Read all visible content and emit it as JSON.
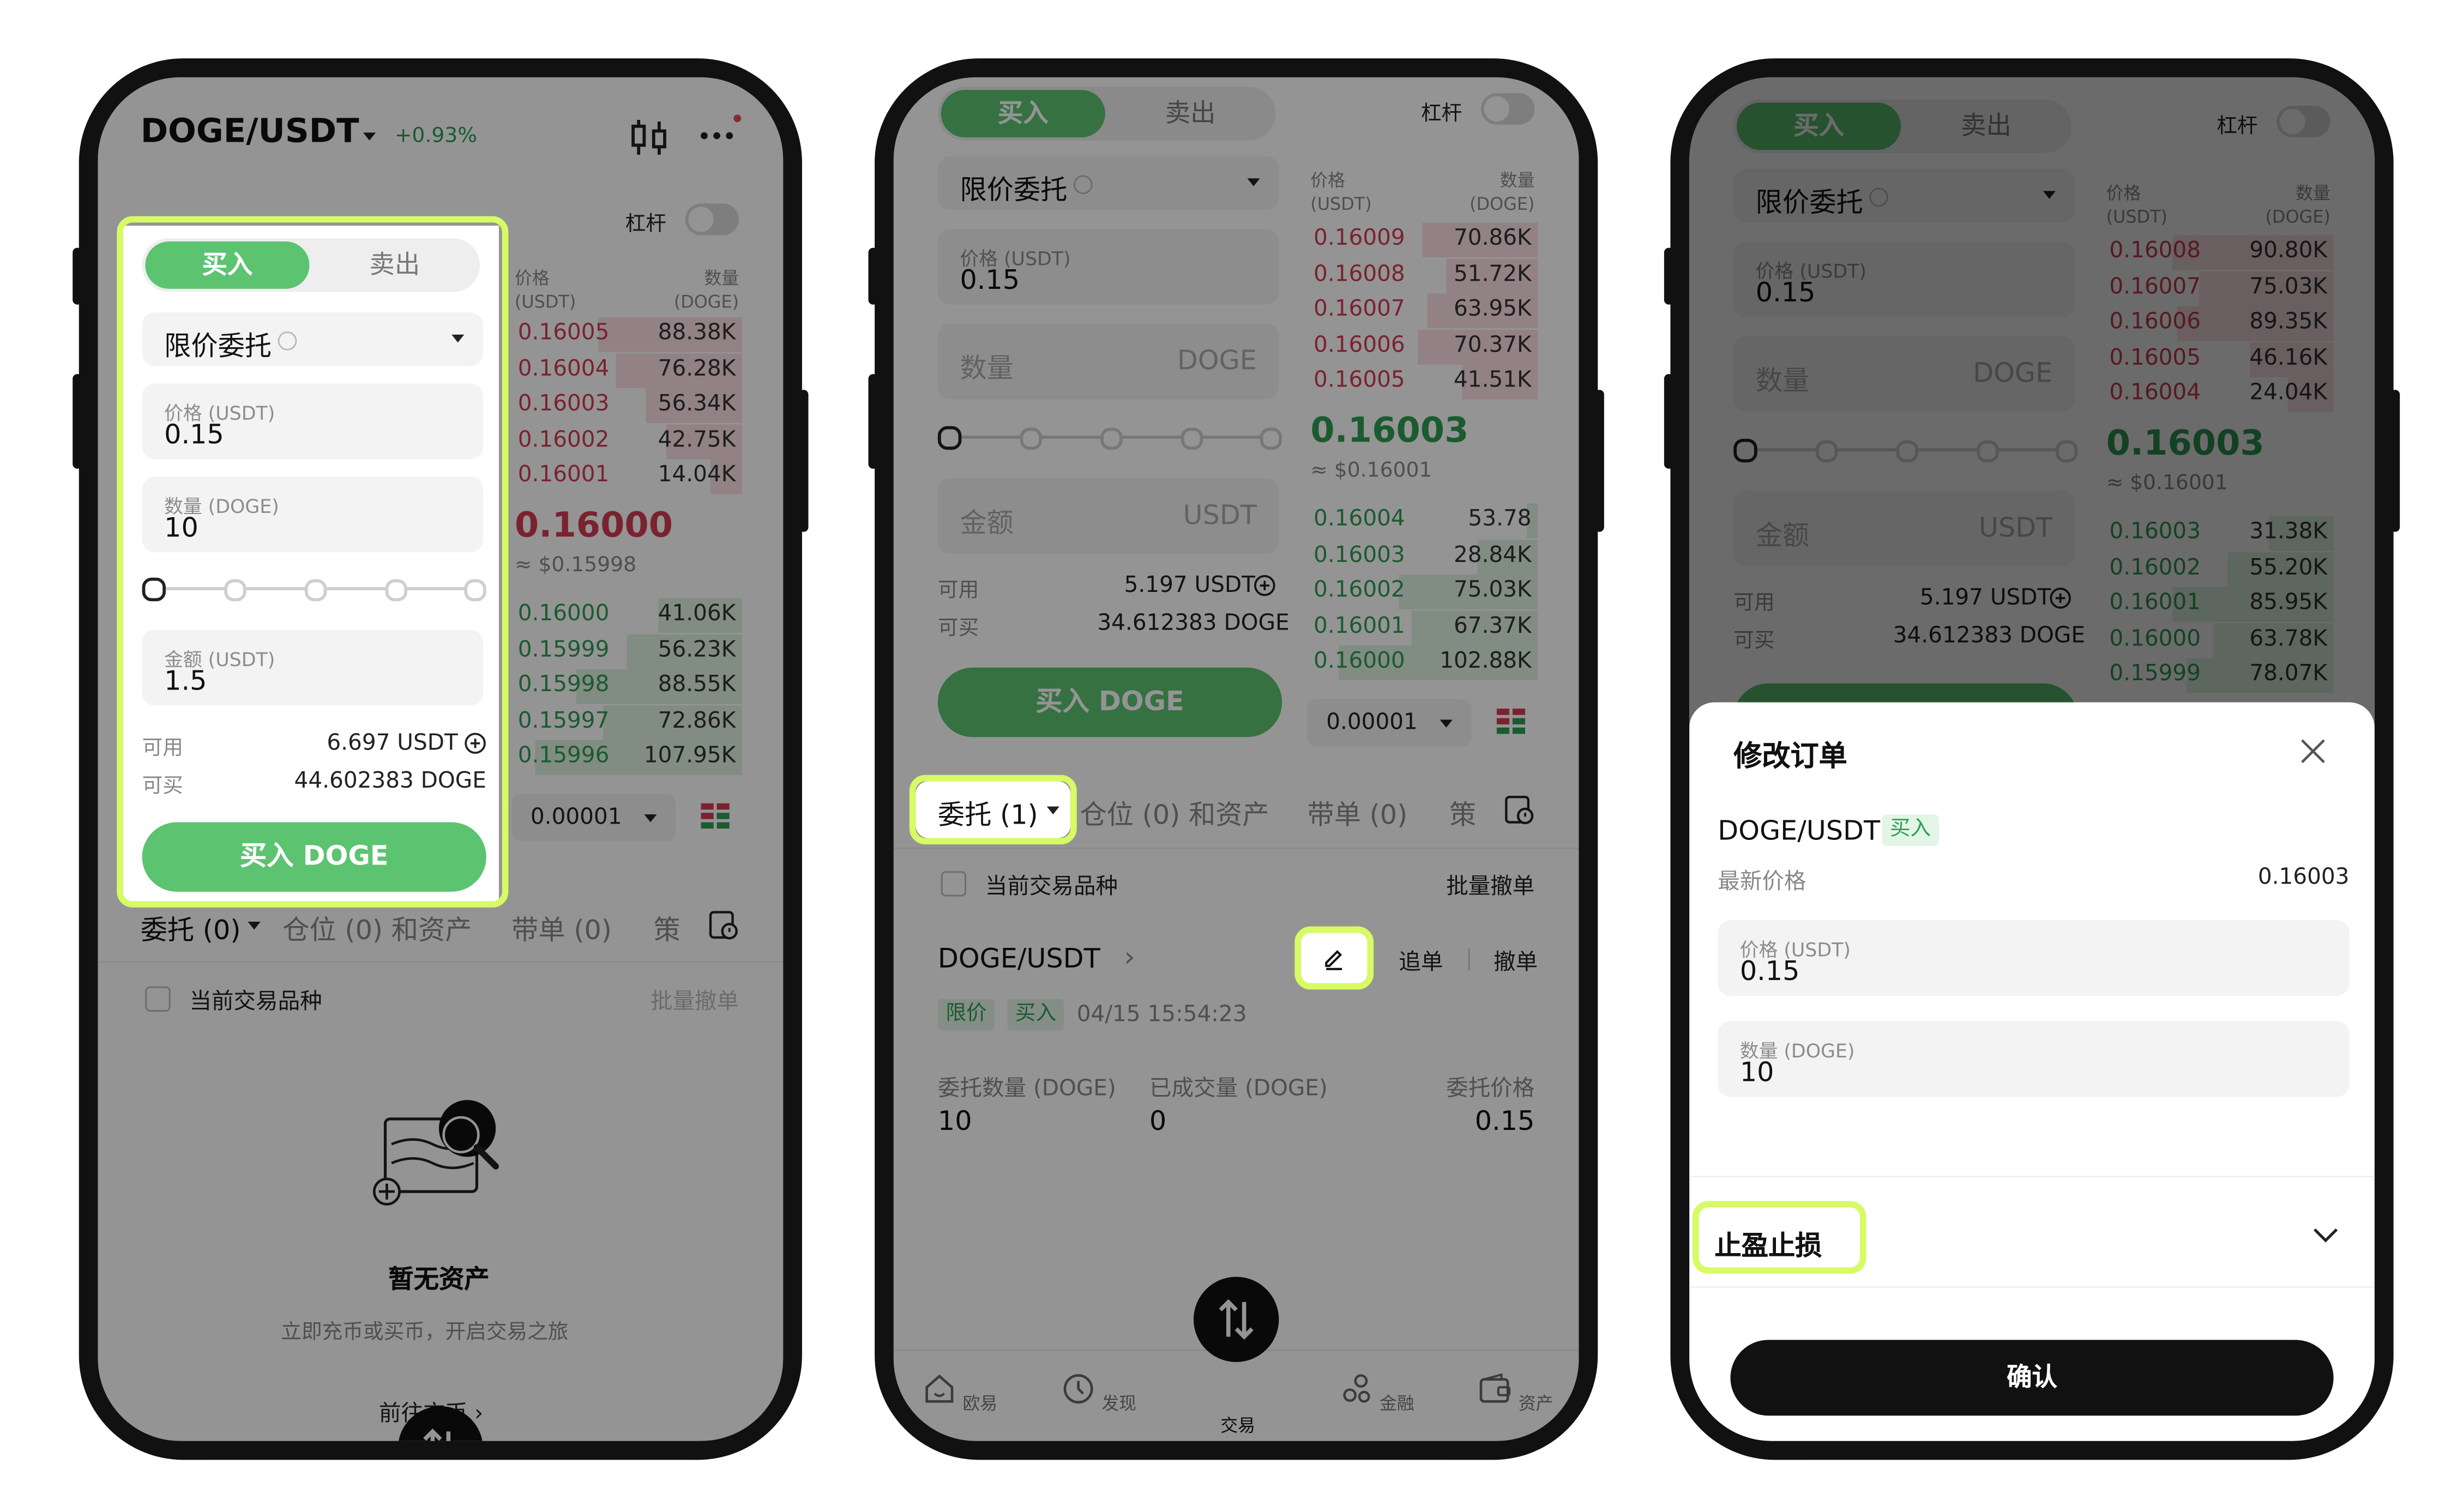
{
  "colors": {
    "buy_green": "#5cc371",
    "price_green": "#2e9d52",
    "price_red": "#d23b52",
    "highlight": "#d6fb64"
  },
  "screen1": {
    "pair": "DOGE/USDT",
    "change": "+0.93%",
    "buy_tab": "买入",
    "sell_tab": "卖出",
    "leverage_label": "杠杆",
    "order_type": "限价委托",
    "price_label": "价格 (USDT)",
    "price_value": "0.15",
    "qty_label": "数量 (DOGE)",
    "qty_value": "10",
    "amount_label": "金额 (USDT)",
    "amount_value": "1.5",
    "available_label": "可用",
    "available_value": "6.697 USDT",
    "can_buy_label": "可买",
    "can_buy_value": "44.602383 DOGE",
    "buy_button": "买入 DOGE",
    "book_price_header": "价格",
    "book_price_unit": "(USDT)",
    "book_qty_header": "数量",
    "book_qty_unit": "(DOGE)",
    "asks": [
      {
        "price": "0.16005",
        "qty": "88.38K",
        "depth": 0.62
      },
      {
        "price": "0.16004",
        "qty": "76.28K",
        "depth": 0.55
      },
      {
        "price": "0.16003",
        "qty": "56.34K",
        "depth": 0.42
      },
      {
        "price": "0.16002",
        "qty": "42.75K",
        "depth": 0.33
      },
      {
        "price": "0.16001",
        "qty": "14.04K",
        "depth": 0.14
      }
    ],
    "mid_price": "0.16000",
    "mid_usd": "≈ $0.15998",
    "bids": [
      {
        "price": "0.16000",
        "qty": "41.06K",
        "depth": 0.36
      },
      {
        "price": "0.15999",
        "qty": "56.23K",
        "depth": 0.5
      },
      {
        "price": "0.15998",
        "qty": "88.55K",
        "depth": 0.72
      },
      {
        "price": "0.15997",
        "qty": "72.86K",
        "depth": 0.6
      },
      {
        "price": "0.15996",
        "qty": "107.95K",
        "depth": 0.9
      }
    ],
    "step_value": "0.00001",
    "tabs": [
      "委托 (0)",
      "仓位 (0) 和资产",
      "带单 (0)",
      "策"
    ],
    "current_pair_label": "当前交易品种",
    "batch_cancel": "批量撤单",
    "empty_title": "暂无资产",
    "empty_desc": "立即充币或买币，开启交易之旅",
    "go_link": "前往充币"
  },
  "screen2": {
    "buy_tab": "买入",
    "sell_tab": "卖出",
    "leverage_label": "杠杆",
    "order_type": "限价委托",
    "price_label": "价格 (USDT)",
    "price_value": "0.15",
    "qty_placeholder": "数量",
    "qty_unit": "DOGE",
    "amount_placeholder": "金额",
    "amount_unit": "USDT",
    "available_label": "可用",
    "available_value": "5.197 USDT",
    "can_buy_label": "可买",
    "can_buy_value": "34.612383 DOGE",
    "buy_button": "买入 DOGE",
    "book_price_header": "价格",
    "book_price_unit": "(USDT)",
    "book_qty_header": "数量",
    "book_qty_unit": "(DOGE)",
    "asks": [
      {
        "price": "0.16009",
        "qty": "70.86K",
        "depth": 0.5
      },
      {
        "price": "0.16008",
        "qty": "51.72K",
        "depth": 0.4
      },
      {
        "price": "0.16007",
        "qty": "63.95K",
        "depth": 0.48
      },
      {
        "price": "0.16006",
        "qty": "70.37K",
        "depth": 0.52
      },
      {
        "price": "0.16005",
        "qty": "41.51K",
        "depth": 0.33
      }
    ],
    "mid_price": "0.16003",
    "mid_usd": "≈ $0.16001",
    "bids": [
      {
        "price": "0.16004",
        "qty": "53.78",
        "depth": 0.05
      },
      {
        "price": "0.16003",
        "qty": "28.84K",
        "depth": 0.26
      },
      {
        "price": "0.16002",
        "qty": "75.03K",
        "depth": 0.6
      },
      {
        "price": "0.16001",
        "qty": "67.37K",
        "depth": 0.55
      },
      {
        "price": "0.16000",
        "qty": "102.88K",
        "depth": 0.86
      }
    ],
    "step_value": "0.00001",
    "tabs": [
      "委托 (1)",
      "仓位 (0) 和资产",
      "带单 (0)",
      "策"
    ],
    "current_pair_label": "当前交易品种",
    "batch_cancel": "批量撤单",
    "order": {
      "pair": "DOGE/USDT",
      "chase": "追单",
      "cancel": "撤单",
      "tag_type": "限价",
      "tag_side": "买入",
      "time": "04/15 15:54:23",
      "qty_label": "委托数量 (DOGE)",
      "qty_value": "10",
      "filled_label": "已成交量 (DOGE)",
      "filled_value": "0",
      "price_label": "委托价格",
      "price_value": "0.15"
    },
    "nav": [
      {
        "label": "欧易",
        "icon": "home-icon"
      },
      {
        "label": "发现",
        "icon": "discover-icon"
      },
      {
        "label": "交易",
        "icon": "trade-icon"
      },
      {
        "label": "金融",
        "icon": "finance-icon"
      },
      {
        "label": "资产",
        "icon": "wallet-icon"
      }
    ]
  },
  "screen3": {
    "buy_tab": "买入",
    "sell_tab": "卖出",
    "leverage_label": "杠杆",
    "order_type": "限价委托",
    "price_label": "价格 (USDT)",
    "price_value": "0.15",
    "qty_placeholder": "数量",
    "qty_unit": "DOGE",
    "amount_placeholder": "金额",
    "amount_unit": "USDT",
    "available_label": "可用",
    "available_value": "5.197 USDT",
    "can_buy_label": "可买",
    "can_buy_value": "34.612383 DOGE",
    "book_price_header": "价格",
    "book_price_unit": "(USDT)",
    "book_qty_header": "数量",
    "book_qty_unit": "(DOGE)",
    "asks": [
      {
        "price": "0.16008",
        "qty": "90.80K",
        "depth": 0.7
      },
      {
        "price": "0.16007",
        "qty": "75.03K",
        "depth": 0.58
      },
      {
        "price": "0.16006",
        "qty": "89.35K",
        "depth": 0.68
      },
      {
        "price": "0.16005",
        "qty": "46.16K",
        "depth": 0.36
      },
      {
        "price": "0.16004",
        "qty": "24.04K",
        "depth": 0.2
      }
    ],
    "mid_price": "0.16003",
    "mid_usd": "≈ $0.16001",
    "bids": [
      {
        "price": "0.16003",
        "qty": "31.38K",
        "depth": 0.28
      },
      {
        "price": "0.16002",
        "qty": "55.20K",
        "depth": 0.46
      },
      {
        "price": "0.16001",
        "qty": "85.95K",
        "depth": 0.7
      },
      {
        "price": "0.16000",
        "qty": "63.78K",
        "depth": 0.52
      },
      {
        "price": "0.15999",
        "qty": "78.07K",
        "depth": 0.64
      }
    ],
    "sheet": {
      "title": "修改订单",
      "pair": "DOGE/USDT",
      "side_tag": "买入",
      "latest_label": "最新价格",
      "latest_value": "0.16003",
      "price_label": "价格 (USDT)",
      "price_value": "0.15",
      "qty_label": "数量 (DOGE)",
      "qty_value": "10",
      "tpsl_label": "止盈止损",
      "confirm": "确认"
    }
  }
}
